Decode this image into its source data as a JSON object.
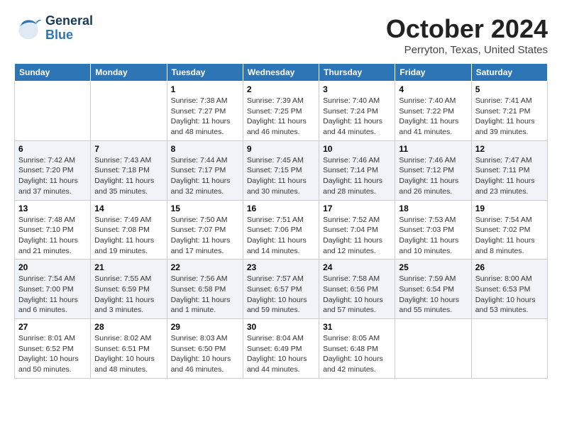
{
  "header": {
    "logo": {
      "general": "General",
      "blue": "Blue"
    },
    "title": "October 2024",
    "subtitle": "Perryton, Texas, United States"
  },
  "weekdays": [
    "Sunday",
    "Monday",
    "Tuesday",
    "Wednesday",
    "Thursday",
    "Friday",
    "Saturday"
  ],
  "weeks": [
    [
      {
        "day": "",
        "info": ""
      },
      {
        "day": "",
        "info": ""
      },
      {
        "day": "1",
        "sunrise": "Sunrise: 7:38 AM",
        "sunset": "Sunset: 7:27 PM",
        "daylight": "Daylight: 11 hours and 48 minutes."
      },
      {
        "day": "2",
        "sunrise": "Sunrise: 7:39 AM",
        "sunset": "Sunset: 7:25 PM",
        "daylight": "Daylight: 11 hours and 46 minutes."
      },
      {
        "day": "3",
        "sunrise": "Sunrise: 7:40 AM",
        "sunset": "Sunset: 7:24 PM",
        "daylight": "Daylight: 11 hours and 44 minutes."
      },
      {
        "day": "4",
        "sunrise": "Sunrise: 7:40 AM",
        "sunset": "Sunset: 7:22 PM",
        "daylight": "Daylight: 11 hours and 41 minutes."
      },
      {
        "day": "5",
        "sunrise": "Sunrise: 7:41 AM",
        "sunset": "Sunset: 7:21 PM",
        "daylight": "Daylight: 11 hours and 39 minutes."
      }
    ],
    [
      {
        "day": "6",
        "sunrise": "Sunrise: 7:42 AM",
        "sunset": "Sunset: 7:20 PM",
        "daylight": "Daylight: 11 hours and 37 minutes."
      },
      {
        "day": "7",
        "sunrise": "Sunrise: 7:43 AM",
        "sunset": "Sunset: 7:18 PM",
        "daylight": "Daylight: 11 hours and 35 minutes."
      },
      {
        "day": "8",
        "sunrise": "Sunrise: 7:44 AM",
        "sunset": "Sunset: 7:17 PM",
        "daylight": "Daylight: 11 hours and 32 minutes."
      },
      {
        "day": "9",
        "sunrise": "Sunrise: 7:45 AM",
        "sunset": "Sunset: 7:15 PM",
        "daylight": "Daylight: 11 hours and 30 minutes."
      },
      {
        "day": "10",
        "sunrise": "Sunrise: 7:46 AM",
        "sunset": "Sunset: 7:14 PM",
        "daylight": "Daylight: 11 hours and 28 minutes."
      },
      {
        "day": "11",
        "sunrise": "Sunrise: 7:46 AM",
        "sunset": "Sunset: 7:12 PM",
        "daylight": "Daylight: 11 hours and 26 minutes."
      },
      {
        "day": "12",
        "sunrise": "Sunrise: 7:47 AM",
        "sunset": "Sunset: 7:11 PM",
        "daylight": "Daylight: 11 hours and 23 minutes."
      }
    ],
    [
      {
        "day": "13",
        "sunrise": "Sunrise: 7:48 AM",
        "sunset": "Sunset: 7:10 PM",
        "daylight": "Daylight: 11 hours and 21 minutes."
      },
      {
        "day": "14",
        "sunrise": "Sunrise: 7:49 AM",
        "sunset": "Sunset: 7:08 PM",
        "daylight": "Daylight: 11 hours and 19 minutes."
      },
      {
        "day": "15",
        "sunrise": "Sunrise: 7:50 AM",
        "sunset": "Sunset: 7:07 PM",
        "daylight": "Daylight: 11 hours and 17 minutes."
      },
      {
        "day": "16",
        "sunrise": "Sunrise: 7:51 AM",
        "sunset": "Sunset: 7:06 PM",
        "daylight": "Daylight: 11 hours and 14 minutes."
      },
      {
        "day": "17",
        "sunrise": "Sunrise: 7:52 AM",
        "sunset": "Sunset: 7:04 PM",
        "daylight": "Daylight: 11 hours and 12 minutes."
      },
      {
        "day": "18",
        "sunrise": "Sunrise: 7:53 AM",
        "sunset": "Sunset: 7:03 PM",
        "daylight": "Daylight: 11 hours and 10 minutes."
      },
      {
        "day": "19",
        "sunrise": "Sunrise: 7:54 AM",
        "sunset": "Sunset: 7:02 PM",
        "daylight": "Daylight: 11 hours and 8 minutes."
      }
    ],
    [
      {
        "day": "20",
        "sunrise": "Sunrise: 7:54 AM",
        "sunset": "Sunset: 7:00 PM",
        "daylight": "Daylight: 11 hours and 6 minutes."
      },
      {
        "day": "21",
        "sunrise": "Sunrise: 7:55 AM",
        "sunset": "Sunset: 6:59 PM",
        "daylight": "Daylight: 11 hours and 3 minutes."
      },
      {
        "day": "22",
        "sunrise": "Sunrise: 7:56 AM",
        "sunset": "Sunset: 6:58 PM",
        "daylight": "Daylight: 11 hours and 1 minute."
      },
      {
        "day": "23",
        "sunrise": "Sunrise: 7:57 AM",
        "sunset": "Sunset: 6:57 PM",
        "daylight": "Daylight: 10 hours and 59 minutes."
      },
      {
        "day": "24",
        "sunrise": "Sunrise: 7:58 AM",
        "sunset": "Sunset: 6:56 PM",
        "daylight": "Daylight: 10 hours and 57 minutes."
      },
      {
        "day": "25",
        "sunrise": "Sunrise: 7:59 AM",
        "sunset": "Sunset: 6:54 PM",
        "daylight": "Daylight: 10 hours and 55 minutes."
      },
      {
        "day": "26",
        "sunrise": "Sunrise: 8:00 AM",
        "sunset": "Sunset: 6:53 PM",
        "daylight": "Daylight: 10 hours and 53 minutes."
      }
    ],
    [
      {
        "day": "27",
        "sunrise": "Sunrise: 8:01 AM",
        "sunset": "Sunset: 6:52 PM",
        "daylight": "Daylight: 10 hours and 50 minutes."
      },
      {
        "day": "28",
        "sunrise": "Sunrise: 8:02 AM",
        "sunset": "Sunset: 6:51 PM",
        "daylight": "Daylight: 10 hours and 48 minutes."
      },
      {
        "day": "29",
        "sunrise": "Sunrise: 8:03 AM",
        "sunset": "Sunset: 6:50 PM",
        "daylight": "Daylight: 10 hours and 46 minutes."
      },
      {
        "day": "30",
        "sunrise": "Sunrise: 8:04 AM",
        "sunset": "Sunset: 6:49 PM",
        "daylight": "Daylight: 10 hours and 44 minutes."
      },
      {
        "day": "31",
        "sunrise": "Sunrise: 8:05 AM",
        "sunset": "Sunset: 6:48 PM",
        "daylight": "Daylight: 10 hours and 42 minutes."
      },
      {
        "day": "",
        "info": ""
      },
      {
        "day": "",
        "info": ""
      }
    ]
  ]
}
